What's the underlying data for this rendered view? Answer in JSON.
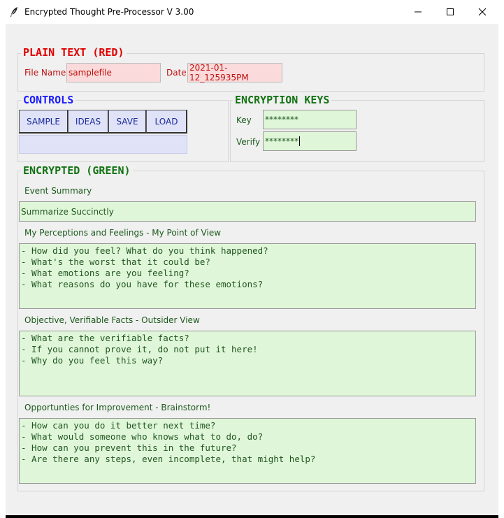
{
  "window": {
    "title": "Encrypted Thought Pre-Processor V 3.00",
    "icon": "feather-icon"
  },
  "plain_text": {
    "heading": "PLAIN TEXT (RED)",
    "file_name_label": "File Name",
    "file_name_value": "samplefile",
    "date_label": "Date",
    "date_value": "2021-01-12_125935PM"
  },
  "controls": {
    "heading": "CONTROLS",
    "buttons": [
      "SAMPLE",
      "IDEAS",
      "SAVE",
      "LOAD"
    ],
    "status_value": ""
  },
  "keys": {
    "heading": "ENCRYPTION KEYS",
    "key_label": "Key",
    "key_value": "********",
    "verify_label": "Verify",
    "verify_value": "********"
  },
  "encrypted": {
    "heading": "ENCRYPTED (GREEN)",
    "summary_label": "Event Summary",
    "summary_value": "Summarize Succinctly",
    "perceptions_label": "My Perceptions and Feelings - My Point of View",
    "perceptions_lines": [
      "- How did you feel? What do you think happened?",
      "- What's the worst that it could be?",
      "- What emotions are you feeling?",
      "- What reasons do you have for these emotions?"
    ],
    "facts_label": "Objective, Verifiable Facts - Outsider View",
    "facts_lines": [
      "- What are the verifiable facts?",
      "- If you cannot prove it, do not put it here!",
      "- Why do you feel this way?"
    ],
    "improvement_label": "Opportunties for Improvement - Brainstorm!",
    "improvement_lines": [
      "- How can you do it better next time?",
      "- What would someone who knows what to do, do?",
      "- How can you prevent this in the future?",
      "- Are there any steps, even incomplete, that might help?"
    ]
  },
  "colors": {
    "red_heading": "#e00000",
    "blue_heading": "#1a1aff",
    "green_heading": "#127312",
    "red_field_bg": "#fadada",
    "green_field_bg": "#dff7d8",
    "blue_field_bg": "#e0e3f8"
  }
}
